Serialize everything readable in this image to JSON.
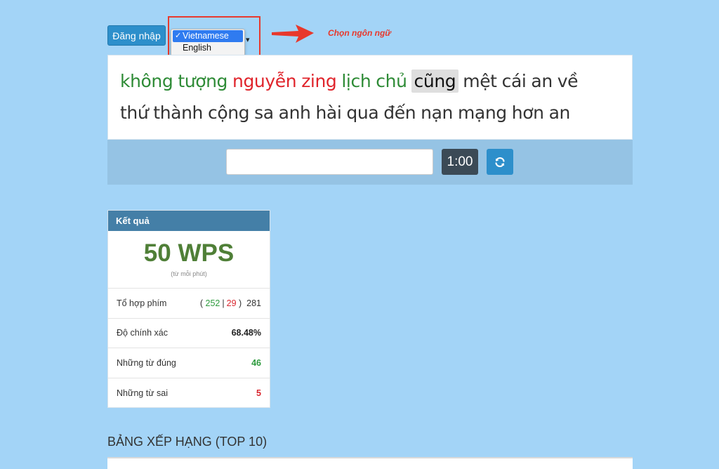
{
  "header": {
    "login_label": "Đăng nhập",
    "language_options": [
      "Vietnamese",
      "English"
    ],
    "selected_language": "Vietnamese",
    "annotation": "Chọn ngôn ngữ",
    "annotation_color": "#e8382c"
  },
  "words": {
    "line1": [
      {
        "text": "không",
        "state": "correct"
      },
      {
        "text": "tượng",
        "state": "correct"
      },
      {
        "text": "nguyễn",
        "state": "wrong"
      },
      {
        "text": "zing",
        "state": "wrong"
      },
      {
        "text": "lịch",
        "state": "correct"
      },
      {
        "text": "chủ",
        "state": "correct"
      },
      {
        "text": "cũng",
        "state": "current"
      },
      {
        "text": "mệt",
        "state": "pending"
      },
      {
        "text": "cái",
        "state": "pending"
      },
      {
        "text": "an",
        "state": "pending"
      },
      {
        "text": "về",
        "state": "pending"
      }
    ],
    "line2": [
      {
        "text": "thứ",
        "state": "pending"
      },
      {
        "text": "thành",
        "state": "pending"
      },
      {
        "text": "cộng",
        "state": "pending"
      },
      {
        "text": "sa",
        "state": "pending"
      },
      {
        "text": "anh",
        "state": "pending"
      },
      {
        "text": "hài",
        "state": "pending"
      },
      {
        "text": "qua",
        "state": "pending"
      },
      {
        "text": "đến",
        "state": "pending"
      },
      {
        "text": "nạn",
        "state": "pending"
      },
      {
        "text": "mạng",
        "state": "pending"
      },
      {
        "text": "hơn",
        "state": "pending"
      },
      {
        "text": "an",
        "state": "pending"
      }
    ]
  },
  "typing": {
    "input_value": "",
    "timer": "1:00"
  },
  "results": {
    "title": "Kết quả",
    "wps": "50 WPS",
    "wps_sub": "(từ mỗi phút)",
    "keystrokes_label": "Tổ hợp phím",
    "keystrokes_correct": "252",
    "keystrokes_wrong": "29",
    "keystrokes_total": "281",
    "accuracy_label": "Độ chính xác",
    "accuracy_value": "68.48%",
    "correct_words_label": "Những từ đúng",
    "correct_words_value": "46",
    "wrong_words_label": "Những từ sai",
    "wrong_words_value": "5"
  },
  "leaderboard": {
    "title": "BẢNG XẾP HẠNG (TOP 10)"
  },
  "colors": {
    "background": "#a3d4f7",
    "correct": "#2e8b36",
    "wrong": "#e0242b",
    "primary": "#2d8fcb",
    "results_header": "#447fa7"
  }
}
